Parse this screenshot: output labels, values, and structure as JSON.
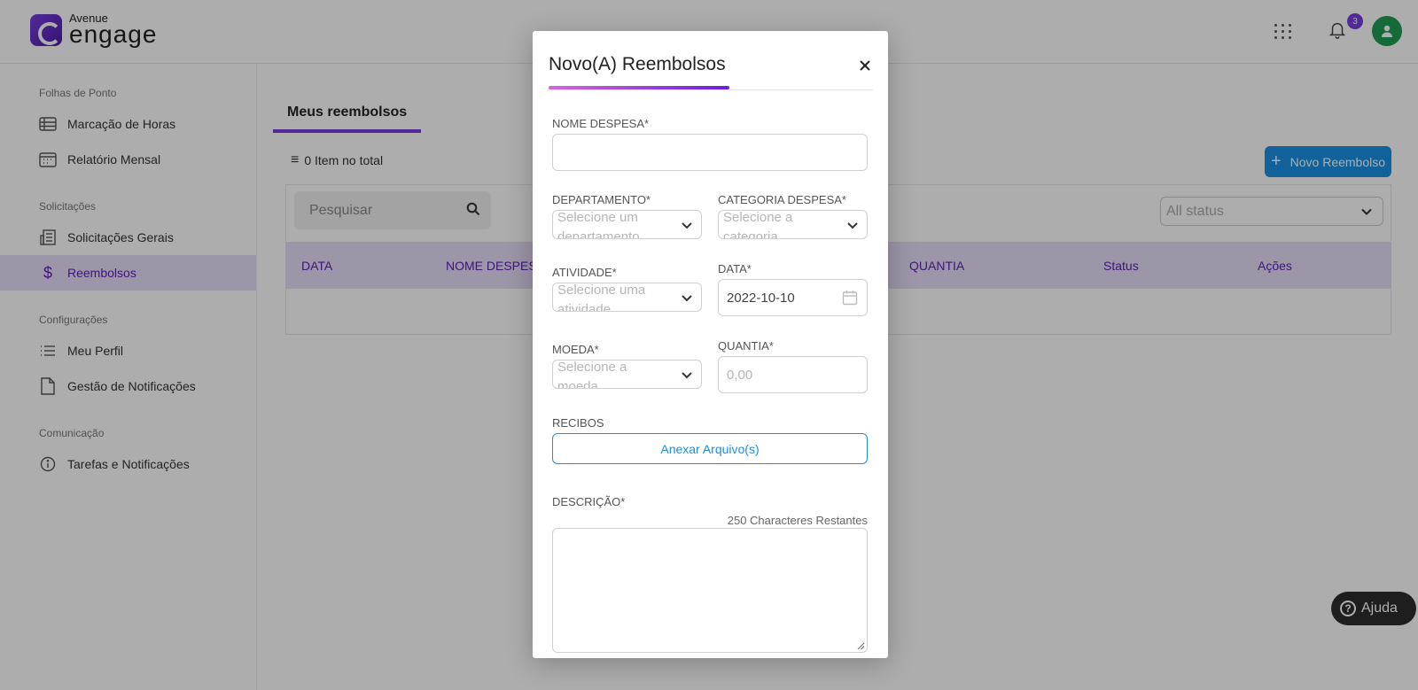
{
  "brand": {
    "small": "Avenue",
    "big": "engage"
  },
  "header": {
    "notification_count": "3"
  },
  "sidebar": {
    "sections": [
      {
        "title": "Folhas de Ponto",
        "items": [
          "Marcação de Horas",
          "Relatório Mensal"
        ]
      },
      {
        "title": "Solicitações",
        "items": [
          "Solicitações Gerais",
          "Reembolsos"
        ]
      },
      {
        "title": "Configurações",
        "items": [
          "Meu Perfil",
          "Gestão de Notificações"
        ]
      },
      {
        "title": "Comunicação",
        "items": [
          "Tarefas e Notificações"
        ]
      }
    ],
    "active_item": "Reembolsos"
  },
  "main": {
    "tab": "Meus reembolsos",
    "total": "0 Item no total",
    "new_button": "Novo Reembolso",
    "search_placeholder": "Pesquisar",
    "status_filter": "All status",
    "columns": [
      "DATA",
      "NOME DESPESA",
      "QUANTIA",
      "Status",
      "Ações"
    ]
  },
  "modal": {
    "title": "Novo(A) Reembolsos",
    "fields": {
      "nome_despesa": {
        "label": "NOME DESPESA*",
        "value": ""
      },
      "departamento": {
        "label": "DEPARTAMENTO*",
        "placeholder": "Selecione um departamento"
      },
      "categoria": {
        "label": "CATEGORIA DESPESA*",
        "placeholder": "Selecione a categoria"
      },
      "atividade": {
        "label": "ATIVIDADE*",
        "placeholder": "Selecione uma atividade"
      },
      "data": {
        "label": "DATA*",
        "value": "2022-10-10"
      },
      "moeda": {
        "label": "MOEDA*",
        "placeholder": "Selecione a moeda"
      },
      "quantia": {
        "label": "QUANTIA*",
        "placeholder": "0,00"
      },
      "recibos": {
        "label": "RECIBOS",
        "button": "Anexar Arquivo(s)"
      },
      "descricao": {
        "label": "DESCRIÇÃO*",
        "chars_left": "250 Characteres Restantes",
        "value": ""
      }
    }
  },
  "help": {
    "label": "Ajuda"
  },
  "colors": {
    "accent": "#7a3ee0",
    "primary_blue": "#1a8fe3",
    "active_bg": "#e8dcf8",
    "avatar": "#1f9d55"
  }
}
